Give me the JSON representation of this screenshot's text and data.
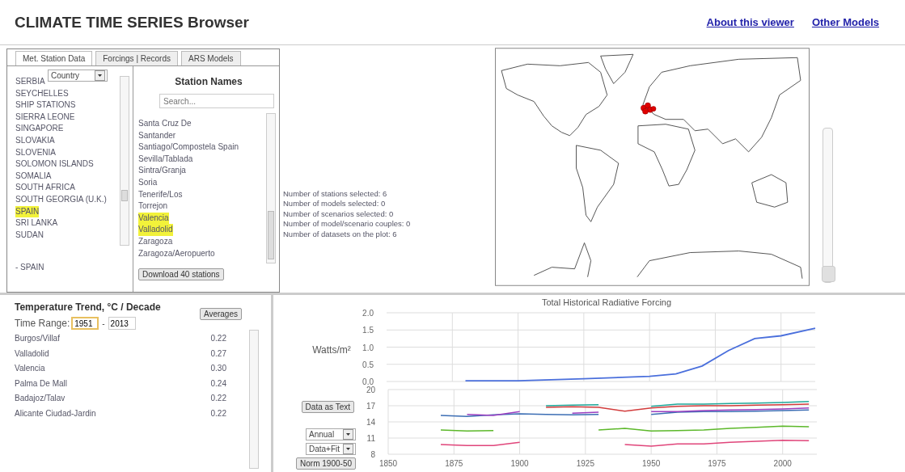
{
  "header": {
    "title": "CLIMATE TIME SERIES Browser",
    "links": [
      "About this viewer",
      "Other Models"
    ]
  },
  "tabs": [
    {
      "label": "Met. Station Data",
      "selected": true
    },
    {
      "label": "Forcings | Records",
      "selected": false
    },
    {
      "label": "ARS Models",
      "selected": false
    }
  ],
  "country_panel": {
    "dropdown": "Country",
    "countries": [
      {
        "name": "SERBIA",
        "selected": false
      },
      {
        "name": "SEYCHELLES",
        "selected": false
      },
      {
        "name": "SHIP STATIONS",
        "selected": false
      },
      {
        "name": "SIERRA LEONE",
        "selected": false
      },
      {
        "name": "SINGAPORE",
        "selected": false
      },
      {
        "name": "SLOVAKIA",
        "selected": false
      },
      {
        "name": "SLOVENIA",
        "selected": false
      },
      {
        "name": "SOLOMON ISLANDS",
        "selected": false
      },
      {
        "name": "SOMALIA",
        "selected": false
      },
      {
        "name": "SOUTH AFRICA",
        "selected": false
      },
      {
        "name": "SOUTH GEORGIA (U.K.)",
        "selected": false
      },
      {
        "name": "SPAIN",
        "selected": true
      },
      {
        "name": "SRI LANKA",
        "selected": false
      },
      {
        "name": "SUDAN",
        "selected": false
      }
    ],
    "chosen": [
      "- SPAIN"
    ]
  },
  "station_panel": {
    "heading": "Station Names",
    "search": {
      "placeholder": "Search..."
    },
    "stations": [
      {
        "name": "Santa Cruz De",
        "selected": false
      },
      {
        "name": "Santander",
        "selected": false
      },
      {
        "name": "Santiago/Compostela Spain",
        "selected": false
      },
      {
        "name": "Sevilla/Tablada",
        "selected": false
      },
      {
        "name": "Sintra/Granja",
        "selected": false
      },
      {
        "name": "Soria",
        "selected": false
      },
      {
        "name": "Tenerife/Los",
        "selected": false
      },
      {
        "name": "Torrejon",
        "selected": false
      },
      {
        "name": "Valencia",
        "selected": true
      },
      {
        "name": "Valladolid",
        "selected": true
      },
      {
        "name": "Zaragoza",
        "selected": false
      },
      {
        "name": "Zaragoza/Aeropuerto",
        "selected": false
      }
    ],
    "download_button": "Download 40 stations"
  },
  "summary": [
    "Number of stations selected: 6",
    "Number of models selected: 0",
    "Number of scenarios selected: 0",
    "Number of model/scenario couples: 0",
    "Number of datasets on the plot: 6"
  ],
  "map_zoom": {
    "level": 0
  },
  "trends": {
    "title": "Temperature Trend, °C / Decade",
    "averages_button": "Averages",
    "time_range": {
      "label": "Time Range:",
      "from": "1951",
      "separator": "-",
      "to": "2013"
    },
    "rows": [
      {
        "station": "Burgos/Villaf",
        "value": "0.22"
      },
      {
        "station": "Valladolid",
        "value": "0.27"
      },
      {
        "station": "Valencia",
        "value": "0.30"
      },
      {
        "station": "Palma De Mall",
        "value": "0.24"
      },
      {
        "station": "Badajoz/Talav",
        "value": "0.22"
      },
      {
        "station": "Alicante Ciudad-Jardin",
        "value": "0.22"
      }
    ]
  },
  "plot_controls": {
    "text_button": "Data as Text",
    "period_select": "Annual",
    "mode_select": "Data+Fit",
    "norm_button": "Norm 1900-50"
  },
  "forcing_chart": {
    "chart_data": {
      "type": "line",
      "title": "Total Historical Radiative Forcing",
      "ylabel": "Watts/m²",
      "xlim": [
        1850,
        2013
      ],
      "ylim": [
        0,
        2
      ],
      "yticks": [
        {
          "value": 0,
          "label": "0.0"
        },
        {
          "value": 0.5,
          "label": "0.5"
        },
        {
          "value": 1,
          "label": "1.0"
        },
        {
          "value": 1.5,
          "label": "1.5"
        },
        {
          "value": 2,
          "label": "2.0"
        }
      ],
      "x": [
        1880,
        1900,
        1925,
        1950,
        1960,
        1970,
        1980,
        1990,
        2000,
        2013
      ],
      "grid": true,
      "series": [
        {
          "color": "#4a6fdc",
          "values": [
            0.02,
            0.02,
            0.08,
            0.15,
            0.22,
            0.45,
            0.9,
            1.25,
            1.33,
            1.55
          ]
        }
      ]
    }
  },
  "temperature_chart": {
    "chart_data": {
      "type": "line",
      "xlim": [
        1850,
        2013
      ],
      "ylim": [
        8,
        20
      ],
      "yticks": [
        8,
        11,
        14,
        17,
        20
      ],
      "xticks": [
        1850,
        1875,
        1900,
        1925,
        1950,
        1975,
        2000
      ],
      "grid": true,
      "x": [
        1870,
        1880,
        1890,
        1900,
        1910,
        1920,
        1930,
        1940,
        1950,
        1960,
        1970,
        1980,
        1990,
        2000,
        2010
      ],
      "series": [
        {
          "color": "#3c6eb4",
          "values": [
            15.2,
            15.0,
            15.3,
            15.5,
            15.4,
            15.3,
            15.4,
            null,
            15.4,
            15.8,
            15.9,
            15.9,
            16.0,
            16.1,
            16.2
          ]
        },
        {
          "color": "#9b3fc0",
          "values": [
            null,
            15.4,
            15.2,
            15.9,
            null,
            15.6,
            15.8,
            null,
            15.9,
            15.9,
            16.1,
            16.2,
            16.3,
            16.4,
            16.6
          ]
        },
        {
          "color": "#20a89a",
          "values": [
            null,
            null,
            null,
            null,
            17.0,
            17.1,
            17.2,
            null,
            16.9,
            17.3,
            17.3,
            17.4,
            17.5,
            17.6,
            17.8
          ]
        },
        {
          "color": "#d23c3c",
          "values": [
            null,
            null,
            null,
            null,
            16.7,
            16.8,
            16.7,
            16.0,
            16.6,
            16.9,
            17.0,
            17.0,
            17.1,
            17.2,
            17.3
          ]
        },
        {
          "color": "#5cb82a",
          "values": [
            12.5,
            12.3,
            12.4,
            null,
            null,
            null,
            12.5,
            12.8,
            12.3,
            12.4,
            12.5,
            12.8,
            13.0,
            13.2,
            13.1
          ]
        },
        {
          "color": "#e0457a",
          "values": [
            9.8,
            9.6,
            9.6,
            10.2,
            null,
            null,
            null,
            9.8,
            9.5,
            9.9,
            9.9,
            10.2,
            10.4,
            10.6,
            10.5
          ]
        }
      ]
    }
  }
}
